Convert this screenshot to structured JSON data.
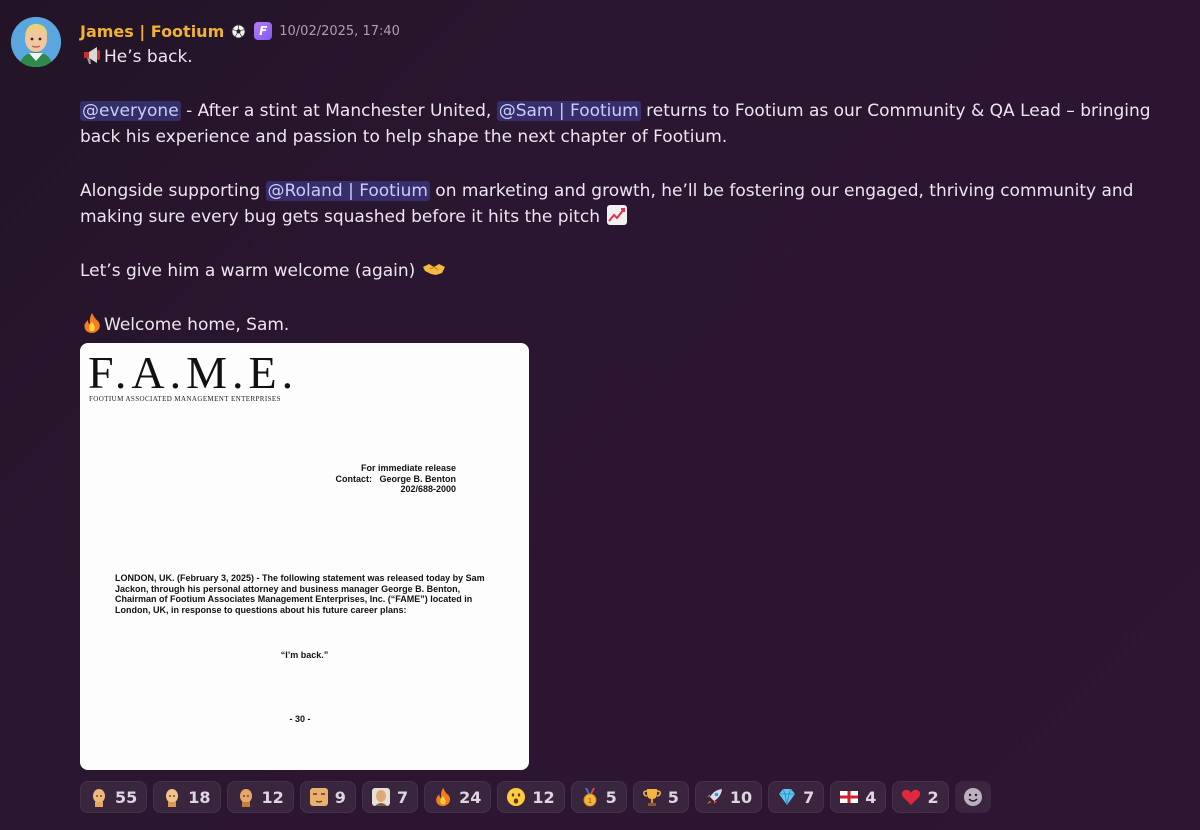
{
  "author": {
    "name": "James | Footium",
    "avatar_icon": "footballer-avatar",
    "badges": [
      "soccer-ball-icon",
      "footium-f-badge"
    ],
    "badge_f_letter": "F",
    "timestamp": "10/02/2025, 17:40"
  },
  "message": {
    "line1": "He’s back.",
    "p2_mention1": "@everyone",
    "p2_text1": " - After a stint at Manchester United, ",
    "p2_mention2": "@Sam | Footium",
    "p2_text2": " returns to Footium as our Community & QA Lead –  bringing back his experience and passion to help shape the next chapter of Footium.",
    "p3_text1": "Alongside supporting ",
    "p3_mention": "@Roland | Footium",
    "p3_text2": " on marketing and growth, he’ll be fostering our engaged, thriving community and making sure every bug gets squashed before it hits the pitch ",
    "p4_text": "Let’s give him a warm welcome (again) ",
    "p5_text": "Welcome home, Sam."
  },
  "attachment": {
    "logo": "F.A.M.E.",
    "subtitle": "FOOTIUM ASSOCIATED MANAGEMENT ENTERPRISES",
    "release_line": "For immediate release",
    "contact_line": "Contact:   George B. Benton",
    "phone_line": "202/688-2000",
    "statement": "LONDON, UK. (February 3, 2025) - The following statement was released today by Sam Jackon, through his personal attorney and business manager George B. Benton, Chairman of Footium Associates Management Enterprises, Inc. (“FAME”) located in London, UK, in response to questions about his future career plans:",
    "quote": "“I’m back.”",
    "end_mark": "- 30 -"
  },
  "reactions": [
    {
      "icon": "bald-head-emoji-1",
      "count": "55"
    },
    {
      "icon": "bald-head-emoji-2",
      "count": "18"
    },
    {
      "icon": "bald-head-emoji-3",
      "count": "12"
    },
    {
      "icon": "face-closeup-emoji",
      "count": "9"
    },
    {
      "icon": "person-portrait-emoji",
      "count": "7"
    },
    {
      "icon": "fire-emoji",
      "count": "24"
    },
    {
      "icon": "surprised-face-emoji",
      "count": "12"
    },
    {
      "icon": "medal-emoji",
      "count": "5"
    },
    {
      "icon": "trophy-emoji",
      "count": "5"
    },
    {
      "icon": "rocket-emoji",
      "count": "10"
    },
    {
      "icon": "gem-emoji",
      "count": "7"
    },
    {
      "icon": "england-flag-emoji",
      "count": "4"
    },
    {
      "icon": "red-heart-emoji",
      "count": "2"
    }
  ],
  "colors": {
    "username": "#f0b232",
    "mention_bg": "#5865f2",
    "background": "#2a1630"
  }
}
